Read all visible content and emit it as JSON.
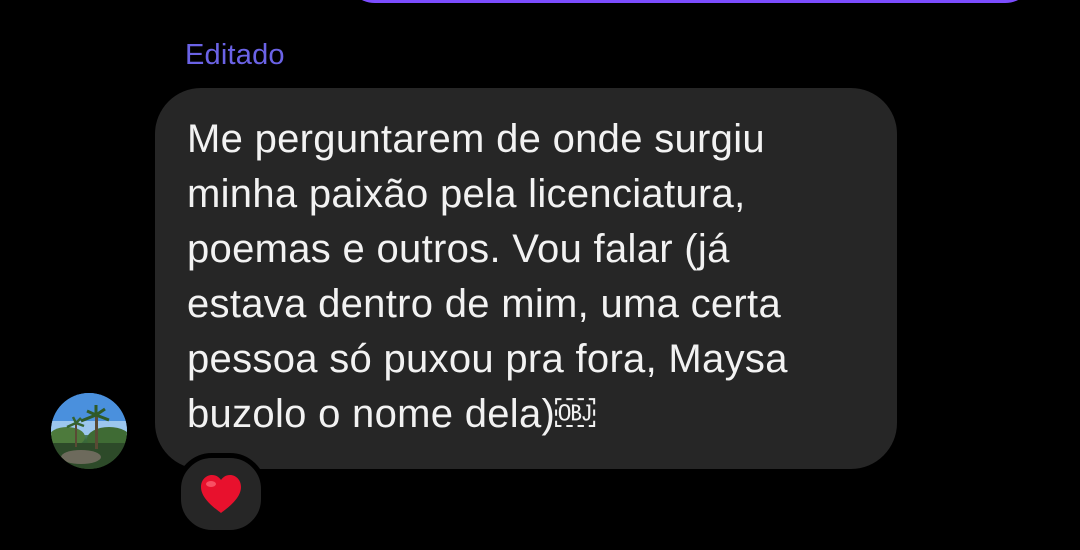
{
  "thread": {
    "message": {
      "edited_label": "Editado",
      "text": "Me perguntarem de onde surgiu\nminha paixão pela licenciatura,\npoemas e outros. Vou falar (já\nestava dentro de mim, uma certa\npessoa só puxou pra fora, Maysa\nbuzolo o nome dela)￼",
      "reaction": "heart-icon"
    },
    "avatar": "avatar-image"
  },
  "colors": {
    "background": "#000000",
    "bubble": "#262626",
    "edited_label": "#6b63e6",
    "sent_bubble_accent": "#7c4dff",
    "reaction_heart": "#e8112d"
  }
}
